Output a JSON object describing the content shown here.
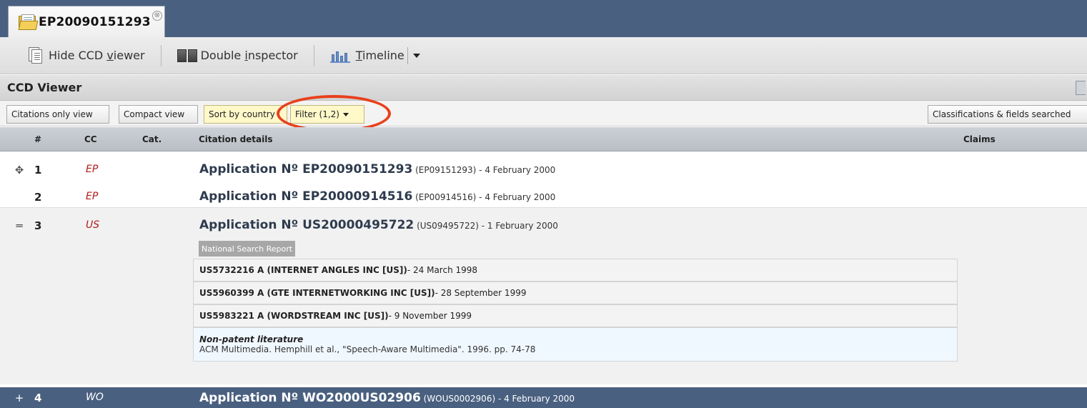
{
  "tab": {
    "title": "EP20090151293",
    "close_glyph": "⊗"
  },
  "toolbar": {
    "hide_ccd_pre": "Hide CCD ",
    "hide_ccd_ul": "v",
    "hide_ccd_post": "iewer",
    "double_pre": "Double ",
    "double_ul": "i",
    "double_post": "nspector",
    "timeline_ul": "T",
    "timeline_post": "imeline"
  },
  "panel": {
    "title": "CCD Viewer"
  },
  "filterbar": {
    "citations_only": "Citations only view",
    "compact": "Compact view",
    "sort_by_country": "Sort by country",
    "filter": "Filter (1,2)",
    "classifications": "Classifications & fields searched"
  },
  "columns": {
    "num": "#",
    "cc": "CC",
    "cat": "Cat.",
    "details": "Citation details",
    "claims": "Claims"
  },
  "rows": [
    {
      "toggle": "✥",
      "num": "1",
      "cc": "EP",
      "title": "Application Nº EP20090151293",
      "rest": " (EP09151293) - 4 February 2000"
    },
    {
      "toggle": "",
      "num": "2",
      "cc": "EP",
      "title": "Application Nº EP20000914516",
      "rest": " (EP00914516) - 4 February 2000"
    },
    {
      "toggle": "═",
      "num": "3",
      "cc": "US",
      "title": "Application Nº US20000495722",
      "rest": " (US09495722) - 1 February 2000"
    },
    {
      "toggle": "+",
      "num": "4",
      "cc": "WO",
      "title": "Application Nº WO2000US02906",
      "rest": " (WOUS0002906) - 4 February 2000"
    }
  ],
  "national_search_report": "National Search Report",
  "citations": [
    {
      "bold": "US5732216 A (INTERNET ANGLES INC [US])",
      "rest": " - 24 March 1998"
    },
    {
      "bold": "US5960399 A (GTE INTERNETWORKING INC [US])",
      "rest": " - 28 September 1999"
    },
    {
      "bold": "US5983221 A (WORDSTREAM INC [US])",
      "rest": " - 9 November 1999"
    }
  ],
  "npl": {
    "heading": "Non-patent literature",
    "text": "ACM Multimedia. Hemphill et al., \"Speech-Aware Multimedia\". 1996. pp. 74-78"
  },
  "colors": {
    "header_blue": "#4a6080",
    "cc_red": "#b01c1c",
    "annotation_red": "#e8401c",
    "filter_yellow": "#fff8c9"
  }
}
